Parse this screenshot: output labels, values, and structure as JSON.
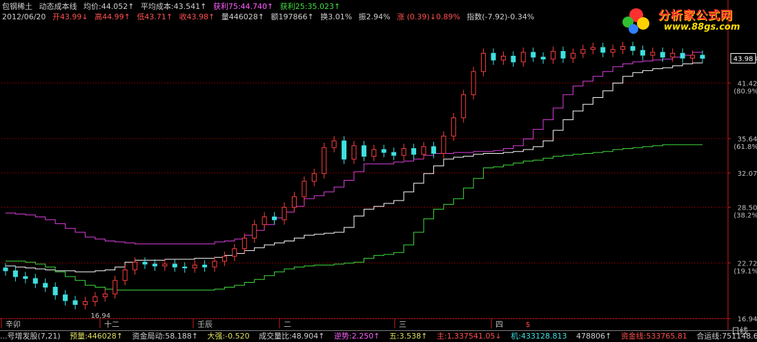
{
  "header": {
    "stock_name": "包钢稀土",
    "indicator_name": "动态成本线",
    "avg_price_label": "均价:44.052↑",
    "avg_cost_label": "平均成本:43.541↑",
    "profit75_label": "获利75:44.740↑",
    "profit25_label": "获利25:35.023↑",
    "date": "2012/06/20",
    "open_label": "开43.99↓",
    "high_label": "高44.99↑",
    "low_label": "低43.71↑",
    "close_label": "收43.98↑",
    "volume_label": "量446028↑",
    "amount_label": "额197866↑",
    "turnover_label": "换3.01%",
    "amplitude_label": "振2.94%",
    "change_label": "涨 (0.39)↓0.89%",
    "index_label": "指数(-7.92)-0.34%"
  },
  "logo": {
    "text": "分析家公式网",
    "url": "www.88gs.com"
  },
  "bottom_bar": {
    "items": [
      "...号增发股(7,21)",
      "预量:446028↑",
      "资金局动:58.188↑",
      "大强:-0.520",
      "成交量比:48.904↑",
      "逆势:2.250↑",
      "五:3.538↑",
      "主:1,337541.05↓",
      "机:433128.813",
      "478806↑",
      "资金线:533765.81",
      "合运线:751148.60"
    ]
  },
  "day_button": "日线",
  "colors": {
    "up": "#ff4040",
    "down": "#40e0e0",
    "avg_cost": "#ffffff",
    "profit75": "#e040e0",
    "profit25": "#40e040",
    "grid": "#800000",
    "axis": "#cc2020"
  },
  "chart_data": {
    "type": "candlestick",
    "y_axis": {
      "range": [
        16.94,
        47.6
      ],
      "ticks": [
        "43.98",
        "41.42",
        "(80.9%)",
        "35.64",
        "(61.8%)",
        "32.07",
        "28.50",
        "(38.2%)",
        "22.72",
        "(19.1%)",
        "16.94"
      ]
    },
    "x_axis_labels": [
      "辛卯",
      "十二",
      "壬辰",
      "二",
      "三",
      "四"
    ],
    "annotations": [
      "16.94",
      "$"
    ],
    "last_price": "43.98",
    "series": [
      {
        "name": "均价",
        "values": [
          22.4,
          22.3,
          22.2,
          22.1,
          22.0,
          21.9,
          21.9,
          21.8,
          21.8,
          21.9,
          22.0,
          22.3,
          22.8,
          23.0,
          23.0,
          23.0,
          23.1,
          23.1,
          23.1,
          23.2,
          23.2,
          23.3,
          23.5,
          23.7,
          24.0,
          24.3,
          24.6,
          24.8,
          25.0,
          25.3,
          25.6,
          25.7,
          25.8,
          25.9,
          26.4,
          27.6,
          28.3,
          28.6,
          28.9,
          29.2,
          30.1,
          31.0,
          32.0,
          32.8,
          33.5,
          33.7,
          33.8,
          34.0,
          34.1,
          34.1,
          34.2,
          34.3,
          34.5,
          34.8,
          35.4,
          36.5,
          37.6,
          38.5,
          39.2,
          39.9,
          40.6,
          41.4,
          42.1,
          42.5,
          42.7,
          42.9,
          43.0,
          43.2,
          43.4,
          43.5,
          43.5
        ]
      },
      {
        "name": "获利75",
        "values": [
          27.9,
          27.8,
          27.7,
          27.5,
          27.2,
          26.8,
          26.3,
          25.9,
          25.4,
          25.2,
          25.0,
          24.9,
          24.8,
          24.7,
          24.7,
          24.7,
          24.7,
          24.7,
          24.7,
          24.7,
          24.7,
          24.9,
          25.0,
          25.2,
          25.6,
          26.1,
          26.7,
          27.4,
          28.0,
          28.6,
          29.4,
          29.7,
          30.1,
          30.6,
          31.3,
          32.2,
          33.0,
          33.0,
          33.0,
          33.2,
          33.3,
          33.5,
          33.9,
          34.1,
          34.1,
          34.2,
          34.2,
          34.3,
          34.3,
          34.4,
          34.6,
          34.9,
          35.6,
          36.6,
          37.6,
          38.8,
          40.2,
          41.1,
          41.6,
          42.1,
          42.6,
          43.1,
          43.4,
          43.6,
          43.7,
          43.8,
          43.9,
          44.1,
          44.3,
          44.6,
          44.7
        ]
      },
      {
        "name": "获利25",
        "values": [
          22.9,
          22.9,
          22.8,
          22.6,
          22.3,
          21.8,
          21.3,
          20.9,
          20.4,
          20.2,
          20.0,
          19.9,
          19.9,
          19.9,
          19.9,
          19.9,
          19.9,
          19.9,
          19.9,
          19.9,
          19.9,
          20.0,
          20.2,
          20.4,
          20.7,
          21.0,
          21.4,
          21.8,
          22.1,
          22.3,
          22.4,
          22.5,
          22.5,
          22.6,
          22.7,
          22.8,
          23.2,
          23.5,
          23.6,
          23.8,
          24.6,
          25.9,
          27.3,
          28.3,
          28.8,
          29.4,
          30.5,
          31.5,
          32.6,
          32.7,
          32.9,
          33.1,
          33.3,
          33.4,
          33.6,
          33.8,
          33.9,
          34.0,
          34.1,
          34.2,
          34.3,
          34.5,
          34.6,
          34.7,
          34.8,
          34.9,
          35.0,
          35.0,
          35.0,
          35.0,
          35.0
        ]
      }
    ]
  }
}
